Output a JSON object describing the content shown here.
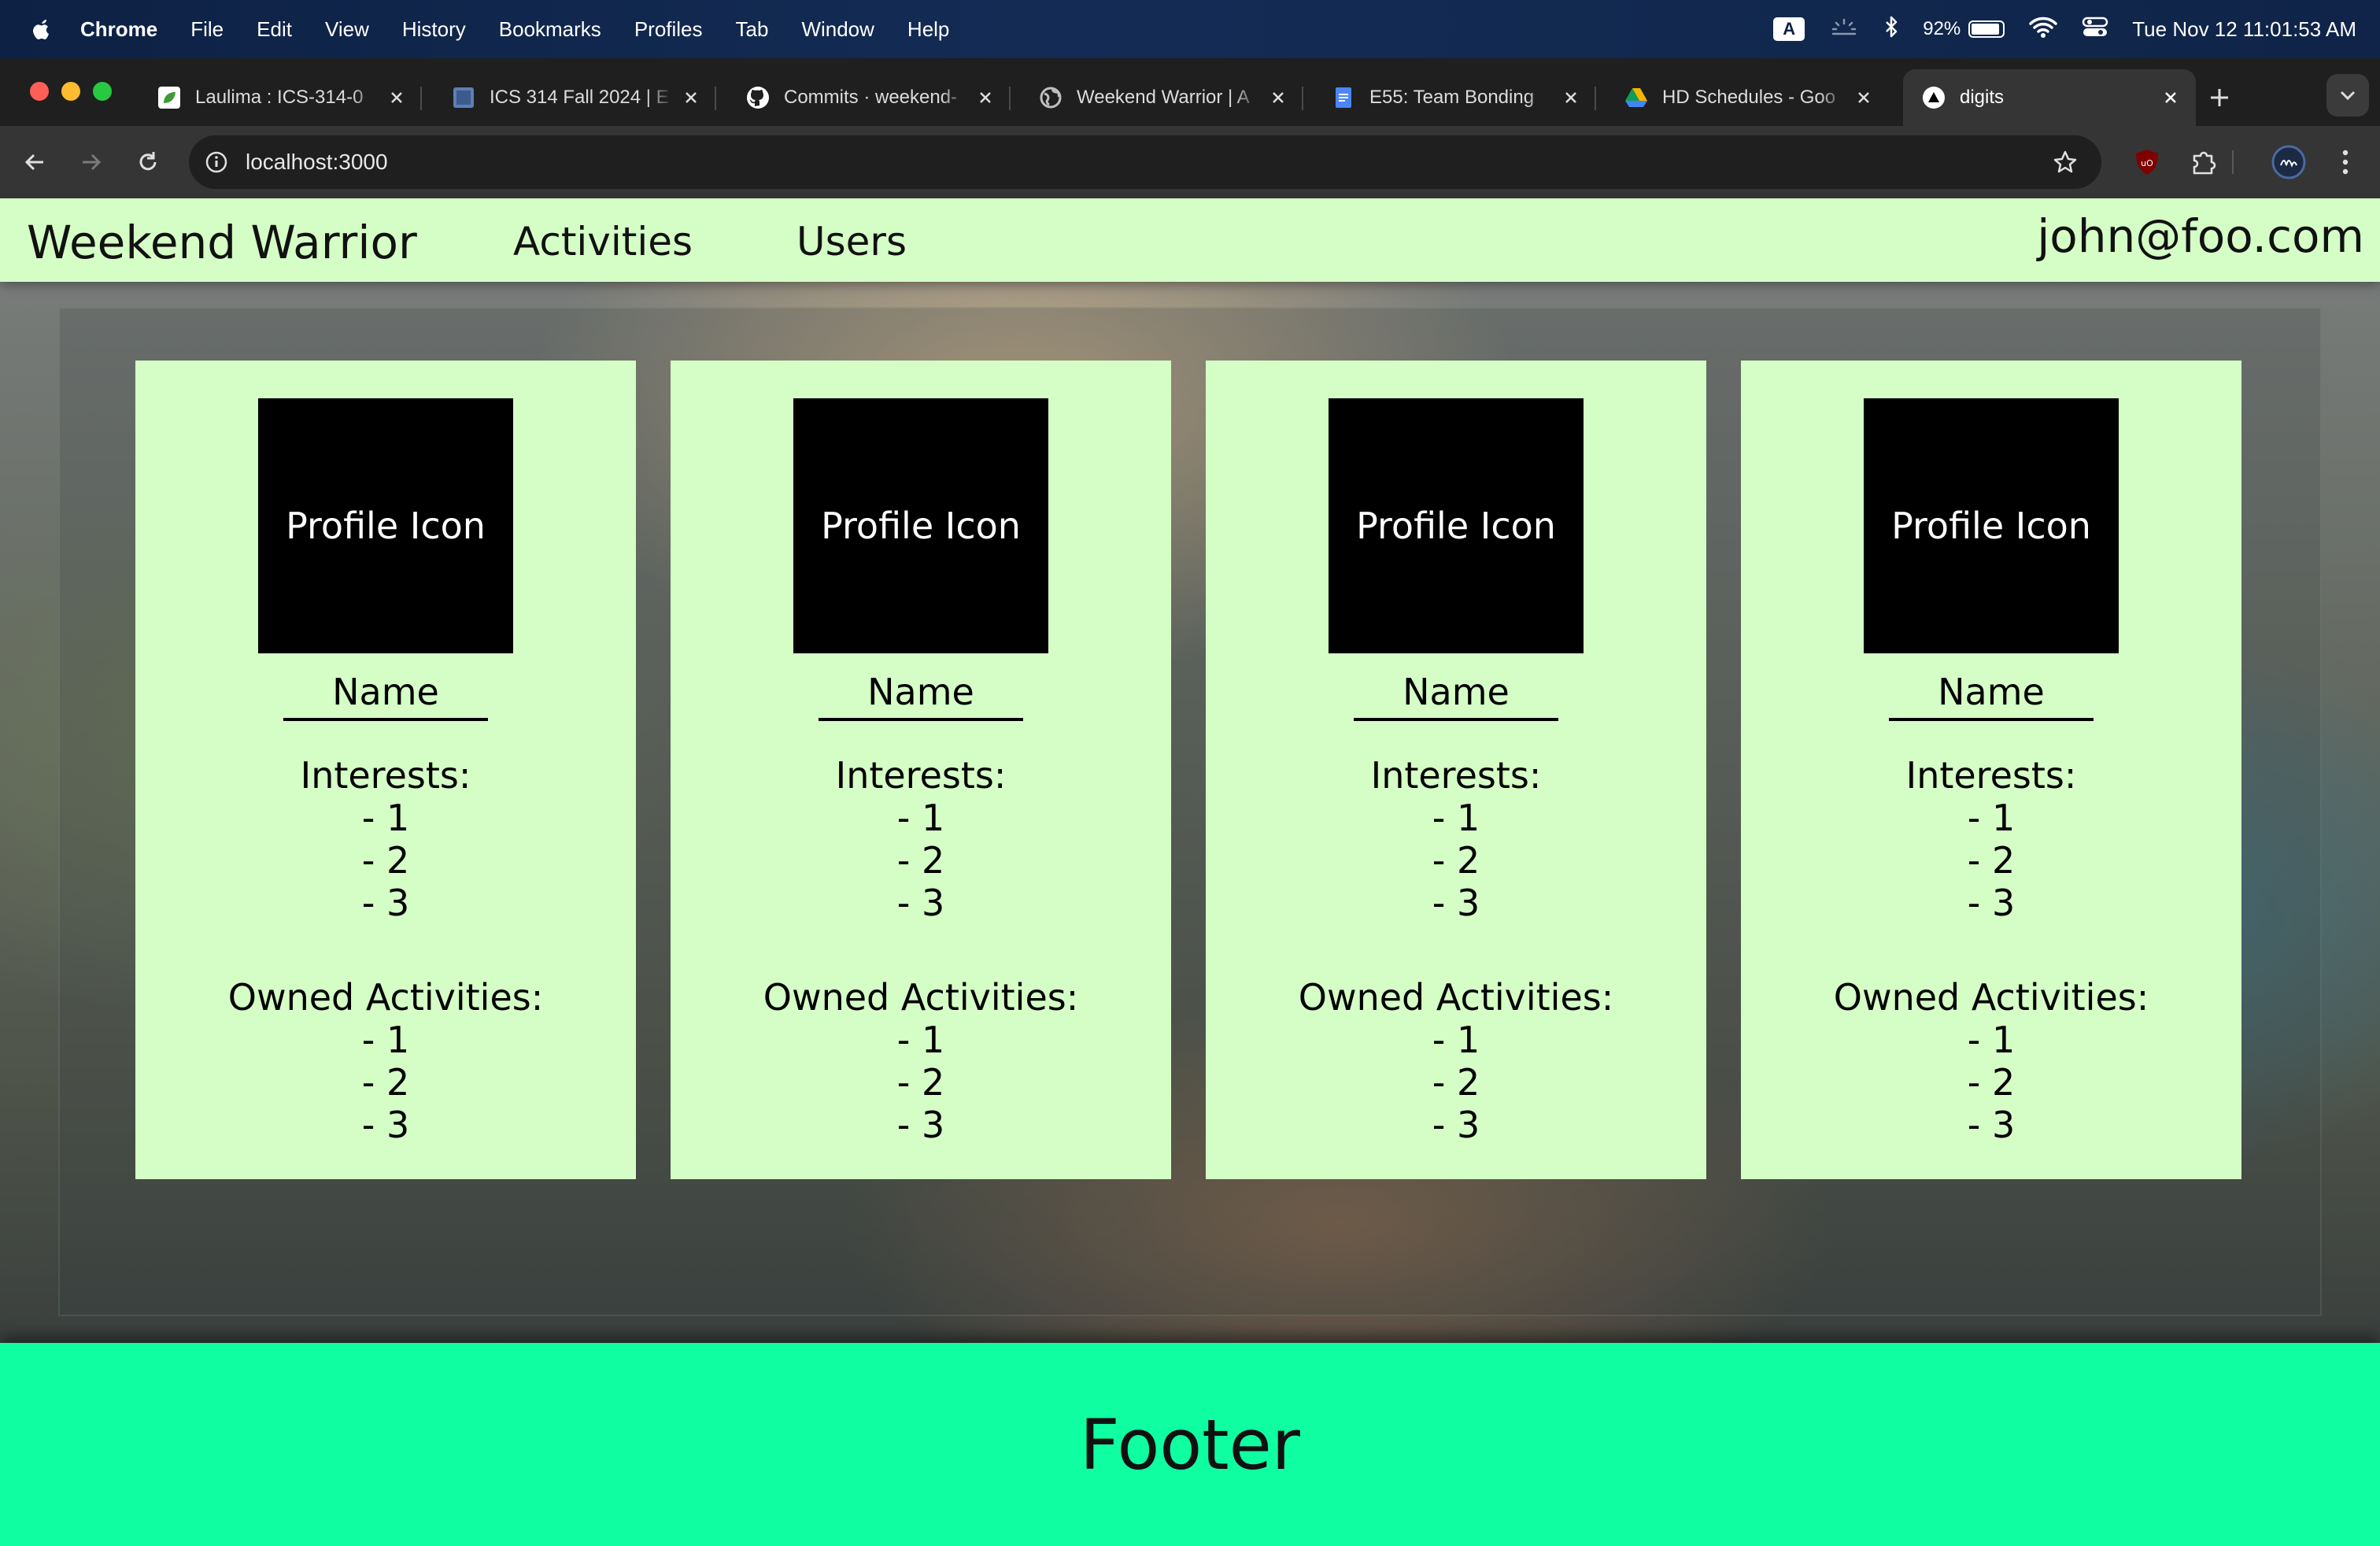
{
  "menubar": {
    "app": "Chrome",
    "items": [
      "File",
      "Edit",
      "View",
      "History",
      "Bookmarks",
      "Profiles",
      "Tab",
      "Window",
      "Help"
    ],
    "input_badge": "A",
    "battery": "92%",
    "battery_level": 0.92,
    "clock": "Tue Nov 12  11:01:53 AM"
  },
  "tabs": [
    {
      "title": "Laulima : ICS-314-0",
      "icon": "laulima-leaf-icon",
      "color": "#4caf50"
    },
    {
      "title": "ICS 314 Fall 2024 | E",
      "icon": "course-site-icon",
      "color": "#5b7fb8"
    },
    {
      "title": "Commits · weekend-",
      "icon": "github-icon",
      "color": "#ffffff"
    },
    {
      "title": "Weekend Warrior | A",
      "icon": "globe-icon",
      "color": "#bfbfbf"
    },
    {
      "title": "E55: Team Bonding",
      "icon": "google-docs-icon",
      "color": "#4a86f7"
    },
    {
      "title": "HD Schedules - Goo",
      "icon": "google-drive-icon",
      "color": "#f4b400"
    },
    {
      "title": "digits",
      "icon": "triangle-icon",
      "color": "#ffffff",
      "active": true
    }
  ],
  "browser": {
    "url": "localhost:3000"
  },
  "site": {
    "brand": "Weekend Warrior",
    "nav": [
      "Activities",
      "Users"
    ],
    "user": "john@foo.com",
    "footer": "Footer"
  },
  "cards": [
    {
      "avatar": "Profile Icon",
      "name": "Name",
      "interests_label": "Interests:",
      "interests": [
        "- 1",
        "- 2",
        "- 3"
      ],
      "activities_label": "Owned Activities:",
      "activities": [
        "- 1",
        "- 2",
        "- 3"
      ]
    },
    {
      "avatar": "Profile Icon",
      "name": "Name",
      "interests_label": "Interests:",
      "interests": [
        "- 1",
        "- 2",
        "- 3"
      ],
      "activities_label": "Owned Activities:",
      "activities": [
        "- 1",
        "- 2",
        "- 3"
      ]
    },
    {
      "avatar": "Profile Icon",
      "name": "Name",
      "interests_label": "Interests:",
      "interests": [
        "- 1",
        "- 2",
        "- 3"
      ],
      "activities_label": "Owned Activities:",
      "activities": [
        "- 1",
        "- 2",
        "- 3"
      ]
    },
    {
      "avatar": "Profile Icon",
      "name": "Name",
      "interests_label": "Interests:",
      "interests": [
        "- 1",
        "- 2",
        "- 3"
      ],
      "activities_label": "Owned Activities:",
      "activities": [
        "- 1",
        "- 2",
        "- 3"
      ]
    }
  ],
  "colors": {
    "navbar": "#d5fdc6",
    "card": "#d5fdc6",
    "footer": "#0ffea2",
    "avatar": "#000000"
  }
}
